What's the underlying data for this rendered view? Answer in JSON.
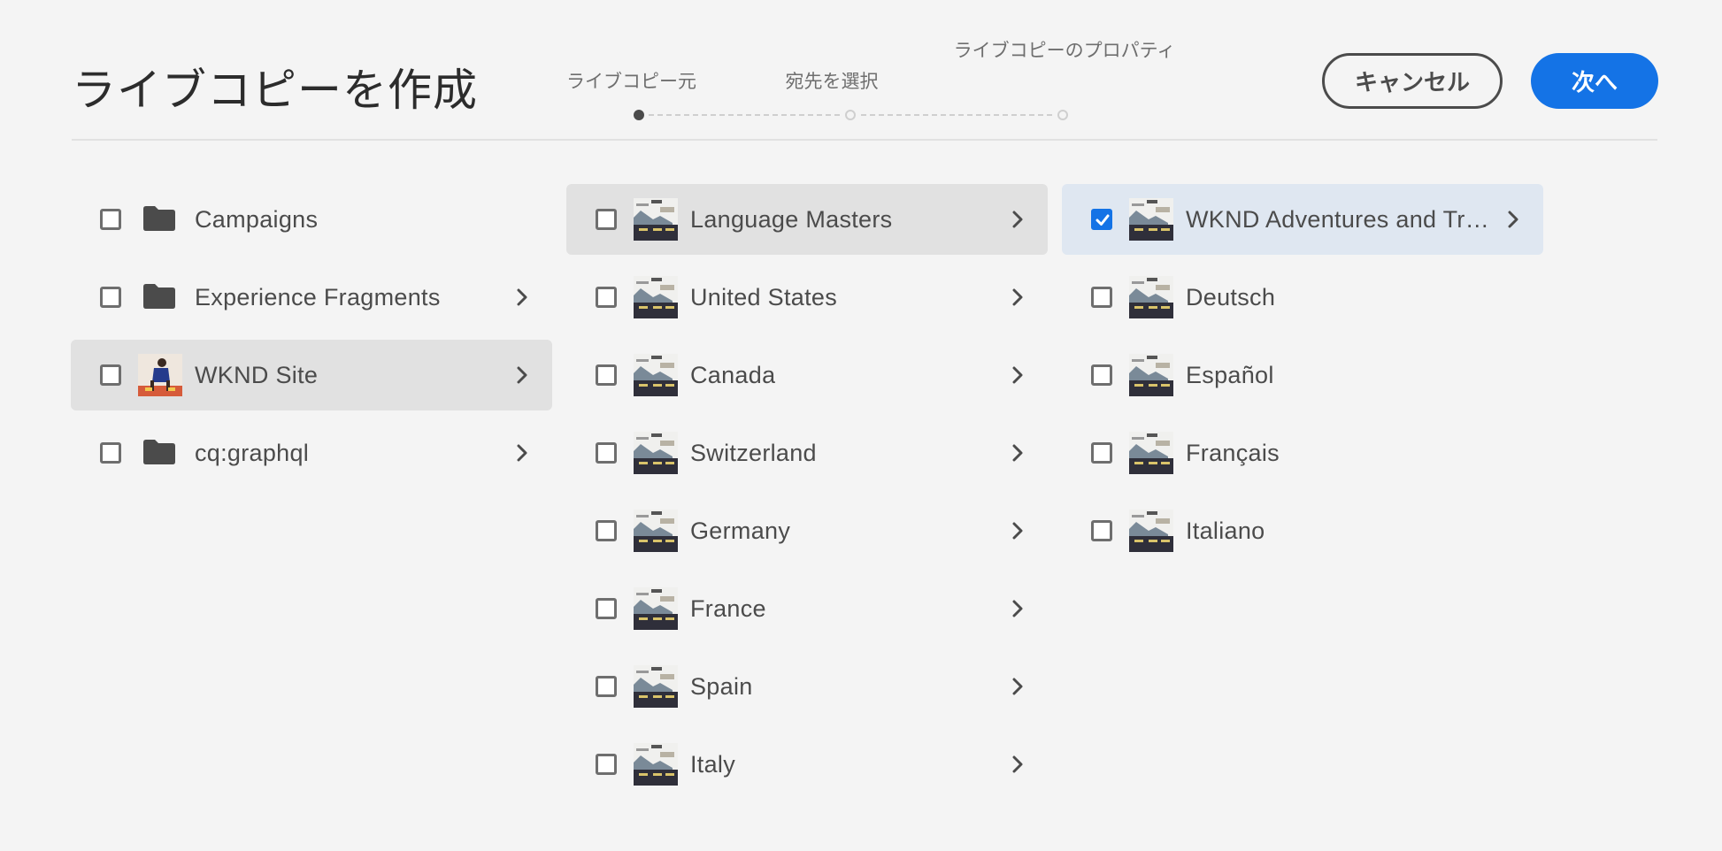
{
  "header": {
    "title": "ライブコピーを作成",
    "steps": [
      {
        "label": "ライブコピー元",
        "state": "active"
      },
      {
        "label": "宛先を選択",
        "state": "pending"
      },
      {
        "label": "ライブコピーのプロパティ",
        "state": "pending"
      }
    ],
    "cancel_label": "キャンセル",
    "next_label": "次へ"
  },
  "colors": {
    "accent": "#1473e6",
    "background": "#f4f4f4",
    "selected_row": "#e1e1e1",
    "checked_row": "#dfe7f1"
  },
  "columns": [
    {
      "items": [
        {
          "label": "Campaigns",
          "icon": "folder-icon",
          "has_children": false,
          "selected": false,
          "checked": false
        },
        {
          "label": "Experience Fragments",
          "icon": "folder-icon",
          "has_children": true,
          "selected": false,
          "checked": false
        },
        {
          "label": "WKND Site",
          "icon": "site-thumbnail",
          "has_children": true,
          "selected": true,
          "checked": false
        },
        {
          "label": "cq:graphql",
          "icon": "folder-icon",
          "has_children": true,
          "selected": false,
          "checked": false
        }
      ]
    },
    {
      "items": [
        {
          "label": "Language Masters",
          "icon": "page-thumbnail",
          "has_children": true,
          "selected": true,
          "checked": false
        },
        {
          "label": "United States",
          "icon": "page-thumbnail",
          "has_children": true,
          "selected": false,
          "checked": false
        },
        {
          "label": "Canada",
          "icon": "page-thumbnail",
          "has_children": true,
          "selected": false,
          "checked": false
        },
        {
          "label": "Switzerland",
          "icon": "page-thumbnail",
          "has_children": true,
          "selected": false,
          "checked": false
        },
        {
          "label": "Germany",
          "icon": "page-thumbnail",
          "has_children": true,
          "selected": false,
          "checked": false
        },
        {
          "label": "France",
          "icon": "page-thumbnail",
          "has_children": true,
          "selected": false,
          "checked": false
        },
        {
          "label": "Spain",
          "icon": "page-thumbnail",
          "has_children": true,
          "selected": false,
          "checked": false
        },
        {
          "label": "Italy",
          "icon": "page-thumbnail",
          "has_children": true,
          "selected": false,
          "checked": false
        }
      ]
    },
    {
      "items": [
        {
          "label": "WKND Adventures and Tr…",
          "icon": "page-thumbnail",
          "has_children": true,
          "selected": false,
          "checked": true
        },
        {
          "label": "Deutsch",
          "icon": "page-thumbnail",
          "has_children": false,
          "selected": false,
          "checked": false
        },
        {
          "label": "Español",
          "icon": "page-thumbnail",
          "has_children": false,
          "selected": false,
          "checked": false
        },
        {
          "label": "Français",
          "icon": "page-thumbnail",
          "has_children": false,
          "selected": false,
          "checked": false
        },
        {
          "label": "Italiano",
          "icon": "page-thumbnail",
          "has_children": false,
          "selected": false,
          "checked": false
        }
      ]
    }
  ]
}
